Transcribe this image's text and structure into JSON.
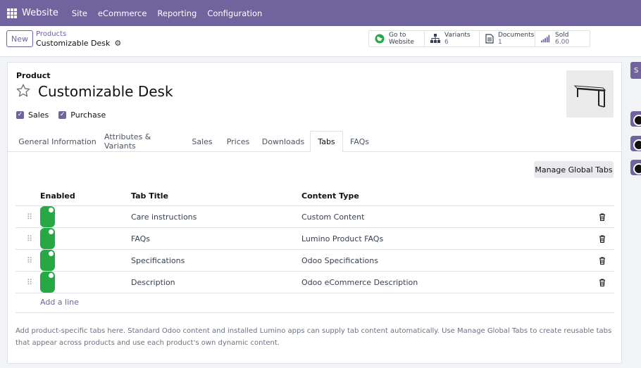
{
  "navbar": {
    "app_name": "Website",
    "menu": [
      "Site",
      "eCommerce",
      "Reporting",
      "Configuration"
    ]
  },
  "control": {
    "new_label": "New",
    "breadcrumb_parent": "Products",
    "breadcrumb_current": "Customizable Desk",
    "smart_buttons": [
      {
        "icon": "globe-icon",
        "label": "Go to",
        "value": "Website"
      },
      {
        "icon": "sitemap-icon",
        "label": "Variants",
        "value": "6"
      },
      {
        "icon": "documents-icon",
        "label": "Documents",
        "value": "1"
      },
      {
        "icon": "bar-chart-icon",
        "label": "Sold",
        "value": "6.00"
      }
    ]
  },
  "form": {
    "section_label": "Product",
    "product_name": "Customizable Desk",
    "checkboxes": [
      {
        "label": "Sales",
        "checked": true
      },
      {
        "label": "Purchase",
        "checked": true
      }
    ],
    "tabs": [
      "General Information",
      "Attributes & Variants",
      "Sales",
      "Prices",
      "Downloads",
      "Tabs",
      "FAQs"
    ],
    "active_tab": "Tabs",
    "manage_global_tabs_label": "Manage Global Tabs",
    "table": {
      "columns": [
        "Enabled",
        "Tab Title",
        "Content Type"
      ],
      "rows": [
        {
          "enabled": true,
          "title": "Care instructions",
          "content_type": "Custom Content"
        },
        {
          "enabled": true,
          "title": "FAQs",
          "content_type": "Lumino Product FAQs"
        },
        {
          "enabled": true,
          "title": "Specifications",
          "content_type": "Odoo Specifications"
        },
        {
          "enabled": true,
          "title": "Description",
          "content_type": "Odoo eCommerce Description"
        }
      ],
      "add_line_label": "Add a line"
    },
    "help_text": "Add product-specific tabs here. Standard Odoo content and installed Lumino apps can supply tab content automatically. Use Manage Global Tabs to create reusable tabs that appear across products and use each product's own dynamic content."
  },
  "side": {
    "button_label": "S"
  },
  "colors": {
    "brand": "#71639e",
    "toggle_on": "#28a745"
  }
}
